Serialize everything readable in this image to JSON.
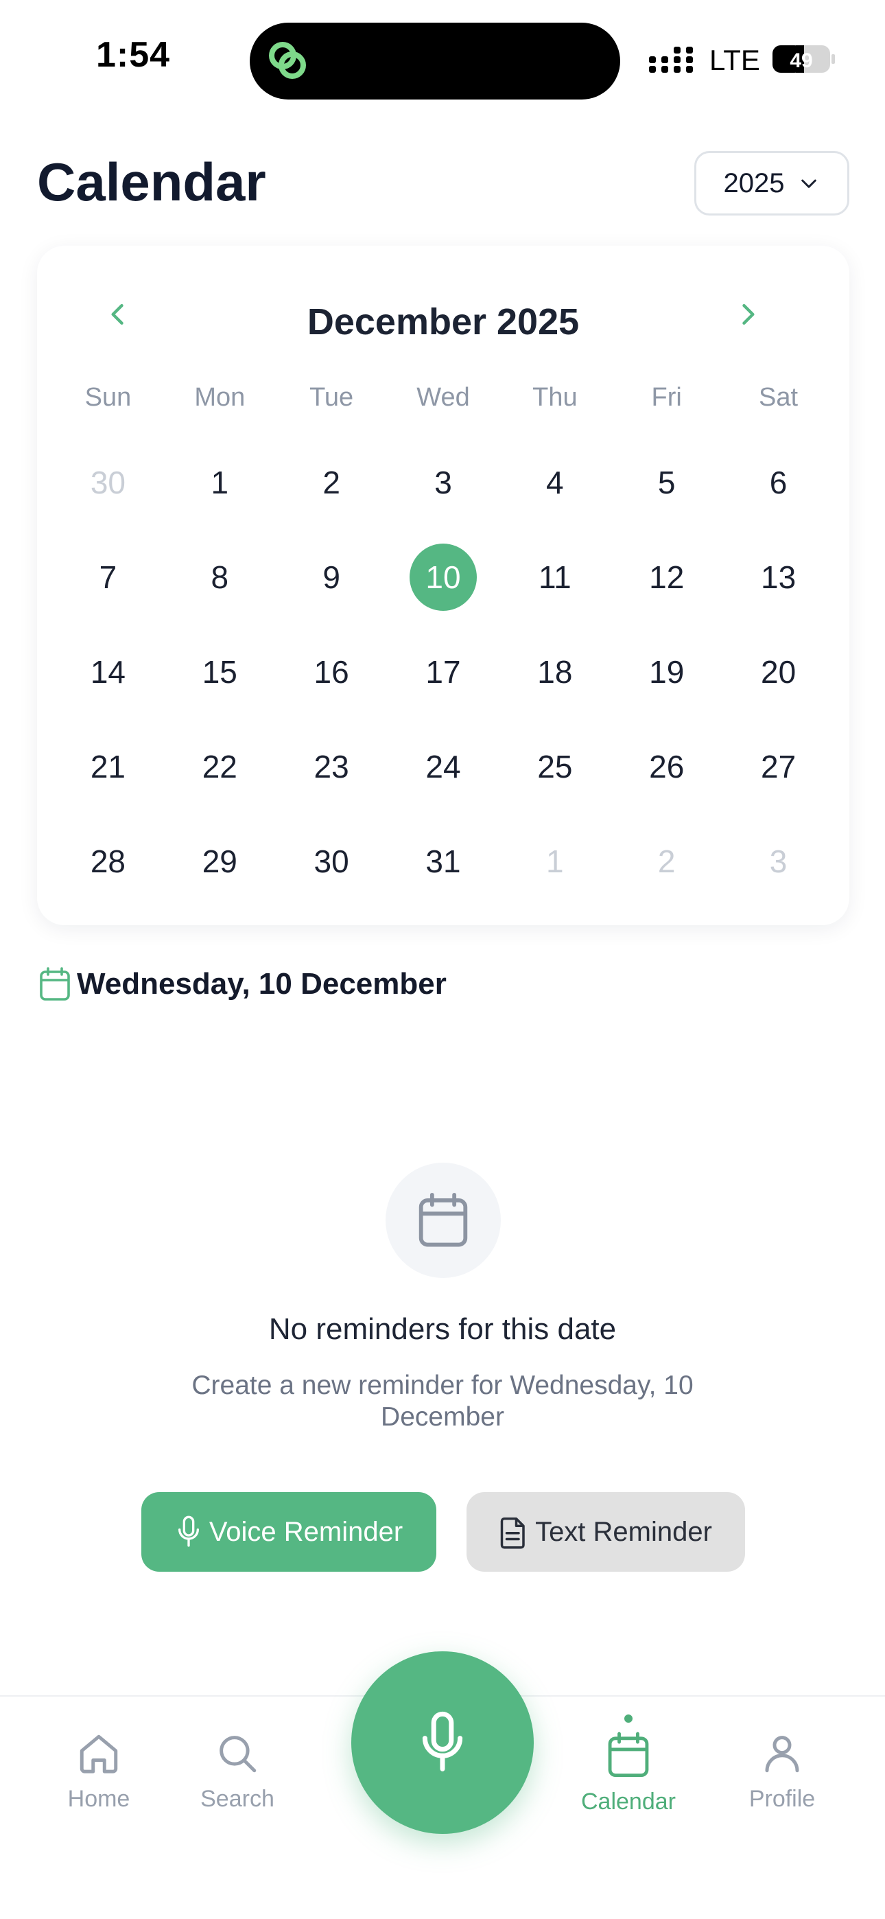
{
  "status_bar": {
    "time": "1:54",
    "network": "LTE",
    "battery": "49"
  },
  "header": {
    "title": "Calendar",
    "year_select": "2025"
  },
  "calendar": {
    "month_label": "December 2025",
    "weekdays": [
      "Sun",
      "Mon",
      "Tue",
      "Wed",
      "Thu",
      "Fri",
      "Sat"
    ],
    "days": [
      {
        "label": "30",
        "muted": true
      },
      {
        "label": "1"
      },
      {
        "label": "2"
      },
      {
        "label": "3"
      },
      {
        "label": "4"
      },
      {
        "label": "5"
      },
      {
        "label": "6"
      },
      {
        "label": "7"
      },
      {
        "label": "8"
      },
      {
        "label": "9"
      },
      {
        "label": "10",
        "selected": true
      },
      {
        "label": "11"
      },
      {
        "label": "12"
      },
      {
        "label": "13"
      },
      {
        "label": "14"
      },
      {
        "label": "15"
      },
      {
        "label": "16"
      },
      {
        "label": "17"
      },
      {
        "label": "18"
      },
      {
        "label": "19"
      },
      {
        "label": "20"
      },
      {
        "label": "21"
      },
      {
        "label": "22"
      },
      {
        "label": "23"
      },
      {
        "label": "24"
      },
      {
        "label": "25"
      },
      {
        "label": "26"
      },
      {
        "label": "27"
      },
      {
        "label": "28"
      },
      {
        "label": "29"
      },
      {
        "label": "30"
      },
      {
        "label": "31"
      },
      {
        "label": "1",
        "muted": true
      },
      {
        "label": "2",
        "muted": true
      },
      {
        "label": "3",
        "muted": true
      }
    ]
  },
  "selected_date": {
    "label": "Wednesday, 10 December",
    "icon": "calendar-icon"
  },
  "empty_state": {
    "icon": "calendar-icon",
    "title": "No reminders for this date",
    "subtitle": "Create a new reminder for Wednesday, 10 December"
  },
  "actions": {
    "voice_label": "Voice Reminder",
    "text_label": "Text Reminder"
  },
  "bottom_nav": {
    "items": [
      {
        "label": "Home",
        "icon": "home-icon"
      },
      {
        "label": "Search",
        "icon": "search-icon"
      },
      {
        "label": "Calendar",
        "icon": "calendar-icon",
        "active": true
      },
      {
        "label": "Profile",
        "icon": "user-icon"
      }
    ],
    "fab_icon": "microphone-icon"
  },
  "colors": {
    "accent": "#55b783",
    "text": "#141a2b",
    "muted": "#c9ced6"
  }
}
